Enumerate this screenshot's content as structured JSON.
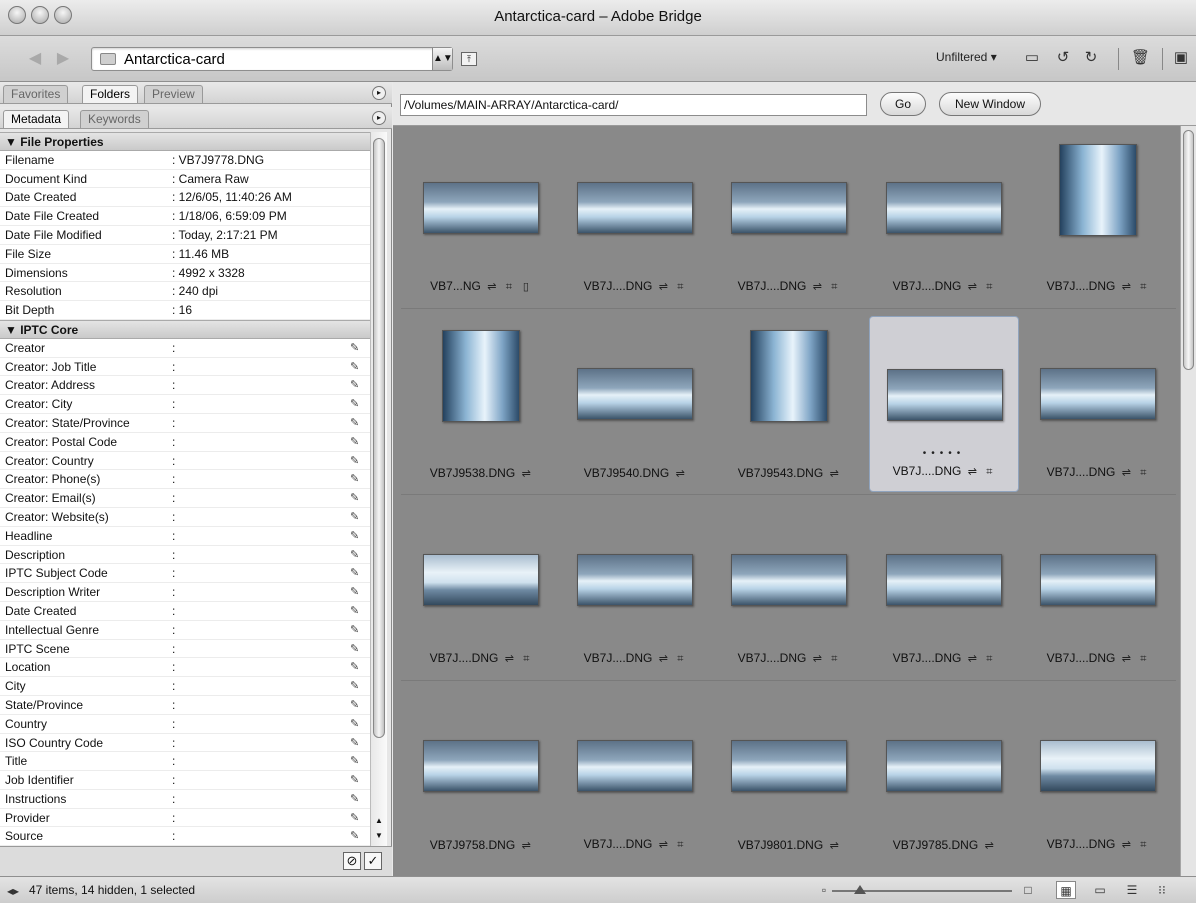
{
  "window": {
    "title": "Antarctica-card – Adobe Bridge"
  },
  "toolbar": {
    "location": "Antarctica-card",
    "filter_label": "Unfiltered"
  },
  "left_panel": {
    "top_tabs": [
      "Favorites",
      "Folders",
      "Preview"
    ],
    "meta_tabs": [
      "Metadata",
      "Keywords"
    ],
    "file_properties_label": "File Properties",
    "file_properties": [
      {
        "key": "Filename",
        "value": "VB7J9778.DNG"
      },
      {
        "key": "Document Kind",
        "value": "Camera Raw"
      },
      {
        "key": "Date Created",
        "value": "12/6/05, 11:40:26 AM"
      },
      {
        "key": "Date File Created",
        "value": "1/18/06, 6:59:09 PM"
      },
      {
        "key": "Date File Modified",
        "value": "Today, 2:17:21 PM"
      },
      {
        "key": "File Size",
        "value": "11.46 MB"
      },
      {
        "key": "Dimensions",
        "value": "4992 x 3328"
      },
      {
        "key": "Resolution",
        "value": "240 dpi"
      },
      {
        "key": "Bit Depth",
        "value": "16"
      }
    ],
    "iptc_label": "IPTC Core",
    "iptc_fields": [
      "Creator",
      "Creator: Job Title",
      "Creator: Address",
      "Creator: City",
      "Creator: State/Province",
      "Creator: Postal Code",
      "Creator: Country",
      "Creator: Phone(s)",
      "Creator: Email(s)",
      "Creator: Website(s)",
      "Headline",
      "Description",
      "IPTC Subject Code",
      "Description Writer",
      "Date Created",
      "Intellectual Genre",
      "IPTC Scene",
      "Location",
      "City",
      "State/Province",
      "Country",
      "ISO Country Code",
      "Title",
      "Job Identifier",
      "Instructions",
      "Provider",
      "Source"
    ]
  },
  "content": {
    "path": "/Volumes/MAIN-ARRAY/Antarctica-card/",
    "go_label": "Go",
    "new_window_label": "New Window",
    "thumbnails": [
      {
        "name": "VB7...NG",
        "style": "wide",
        "crop": true,
        "doc": true
      },
      {
        "name": "VB7J....DNG",
        "style": "wide",
        "crop": true
      },
      {
        "name": "VB7J....DNG",
        "style": "wide",
        "crop": true
      },
      {
        "name": "VB7J....DNG",
        "style": "wide",
        "crop": true
      },
      {
        "name": "VB7J....DNG",
        "style": "tall",
        "crop": true
      },
      {
        "name": "VB7J9538.DNG",
        "style": "tall",
        "crop": false
      },
      {
        "name": "VB7J9540.DNG",
        "style": "wide",
        "crop": false
      },
      {
        "name": "VB7J9543.DNG",
        "style": "tall",
        "crop": false
      },
      {
        "name": "VB7J....DNG",
        "style": "wide",
        "crop": true,
        "selected": true
      },
      {
        "name": "VB7J....DNG",
        "style": "wide",
        "crop": true
      },
      {
        "name": "VB7J....DNG",
        "style": "peak",
        "crop": true
      },
      {
        "name": "VB7J....DNG",
        "style": "wide",
        "crop": true
      },
      {
        "name": "VB7J....DNG",
        "style": "wide",
        "crop": true
      },
      {
        "name": "VB7J....DNG",
        "style": "wide",
        "crop": true
      },
      {
        "name": "VB7J....DNG",
        "style": "wide",
        "crop": true
      },
      {
        "name": "VB7J9758.DNG",
        "style": "wide",
        "crop": false
      },
      {
        "name": "VB7J....DNG",
        "style": "wide",
        "crop": true
      },
      {
        "name": "VB7J9801.DNG",
        "style": "wide",
        "crop": false
      },
      {
        "name": "VB7J9785.DNG",
        "style": "wide",
        "crop": false
      },
      {
        "name": "VB7J....DNG",
        "style": "peak",
        "crop": true
      }
    ]
  },
  "status": {
    "text": "47 items, 14 hidden, 1 selected"
  }
}
